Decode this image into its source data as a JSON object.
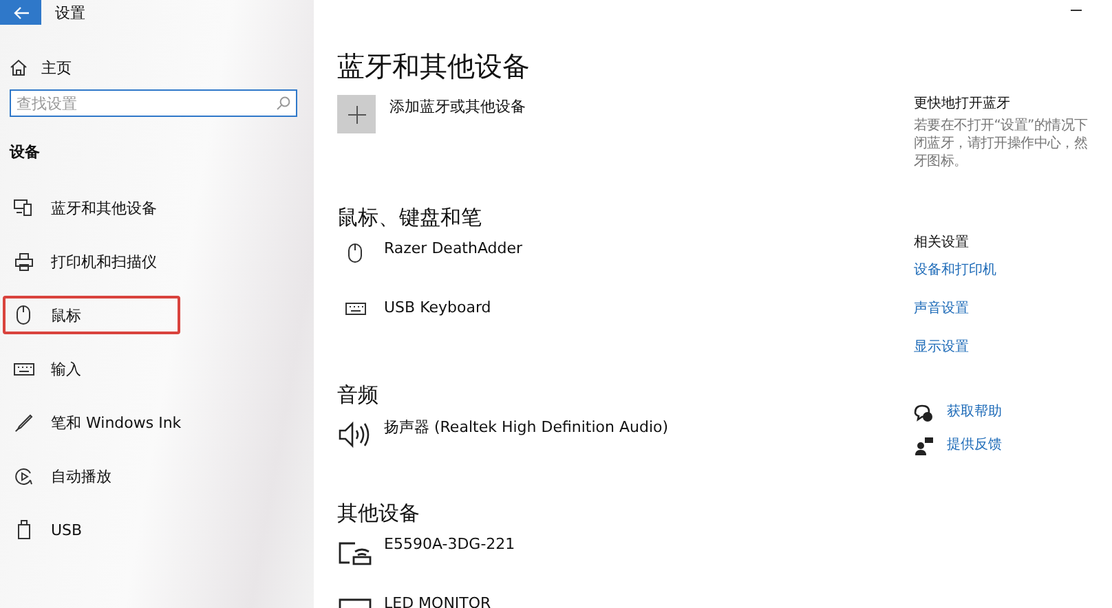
{
  "window": {
    "title": "设置"
  },
  "sidebar": {
    "home": "主页",
    "search": {
      "placeholder": "查找设置"
    },
    "section": "设备",
    "items": [
      {
        "label": "蓝牙和其他设备",
        "kind": "devices",
        "selected": false
      },
      {
        "label": "打印机和扫描仪",
        "kind": "printer",
        "selected": false
      },
      {
        "label": "鼠标",
        "kind": "mouse",
        "selected": true
      },
      {
        "label": "输入",
        "kind": "keyboard",
        "selected": false
      },
      {
        "label": "笔和 Windows Ink",
        "kind": "pen",
        "selected": false
      },
      {
        "label": "自动播放",
        "kind": "autoplay",
        "selected": false
      },
      {
        "label": "USB",
        "kind": "usb",
        "selected": false
      }
    ]
  },
  "main": {
    "title": "蓝牙和其他设备",
    "add_button": "添加蓝牙或其他设备",
    "groups": [
      {
        "heading": "鼠标、键盘和笔",
        "devices": [
          {
            "name": "Razer DeathAdder",
            "kind": "mouse"
          },
          {
            "name": "USB Keyboard",
            "kind": "keyboard"
          }
        ]
      },
      {
        "heading": "音频",
        "devices": [
          {
            "name": "扬声器 (Realtek High Definition Audio)",
            "kind": "speaker"
          }
        ]
      },
      {
        "heading": "其他设备",
        "devices": [
          {
            "name": "E5590A-3DG-221",
            "kind": "router"
          },
          {
            "name": "LED MONITOR",
            "kind": "monitor"
          }
        ]
      }
    ]
  },
  "aside": {
    "tip_title": "更快地打开蓝牙",
    "tip_lines": [
      "若要在不打开“设置”的情况下",
      "闭蓝牙，请打开操作中心，然",
      "牙图标。"
    ],
    "related_heading": "相关设置",
    "related_links": [
      "设备和打印机",
      "声音设置",
      "显示设置"
    ],
    "support": [
      {
        "label": "获取帮助",
        "kind": "help"
      },
      {
        "label": "提供反馈",
        "kind": "feedback"
      }
    ]
  }
}
